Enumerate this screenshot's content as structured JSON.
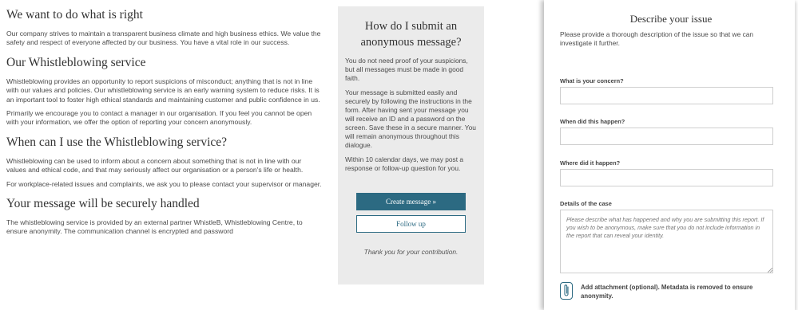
{
  "info": {
    "h1": "We want to do what is right",
    "p1": "Our company strives to maintain a transparent business climate and high business ethics. We value the safety and respect of everyone affected by our business. You have a vital role in our success.",
    "h2": "Our Whistleblowing service",
    "p2": "Whistleblowing provides an opportunity to report suspicions of misconduct; anything that is not in line with our values and policies.  Our whistleblowing service is an early warning system to reduce risks. It is an important tool to foster high ethical standards and maintaining customer and public confidence in us.",
    "p3": "Primarily we encourage you to contact a manager in our organisation. If you feel you cannot be open with your information, we offer the option of reporting your concern anonymously.",
    "h3": "When can I use the Whistleblowing service?",
    "p4": "Whistleblowing can be used to inform about a concern about something that is not in line with our values and ethical code, and that may seriously affect our organisation or a person's life or health.",
    "p5": "For workplace-related issues and complaints, we ask you to please contact your supervisor or manager.",
    "h4": "Your message will be securely handled",
    "p6": "The whistleblowing service is provided by an external partner WhistleB, Whistleblowing Centre, to ensure anonymity. The communication channel is encrypted and password"
  },
  "card": {
    "title": "How do I submit an anonymous message?",
    "p1": "You do not need proof of your suspicions, but all messages must be made in good faith.",
    "p2": "Your message is submitted easily and securely by following the instructions in the form. After having sent your message you will receive an ID and a password on the screen. Save these in a secure manner. You will remain anonymous throughout this dialogue.",
    "p3": "Within 10 calendar days, we may post a response or follow-up question for you.",
    "create_label": "Create message »",
    "follow_label": "Follow up",
    "thanks": "Thank you for your contribution."
  },
  "form": {
    "title": "Describe your issue",
    "description": "Please provide a thorough description of the issue so that we can investigate it further.",
    "concern_label": "What is your concern?",
    "concern_value": "",
    "when_label": "When did this happen?",
    "when_value": "",
    "where_label": "Where did it happen?",
    "where_value": "",
    "details_label": "Details of the case",
    "details_placeholder": "Please describe what has happened and why you are submitting this report. If you wish to be anonymous, make sure that you do not include information in the report that can reveal your identity.",
    "attachment_label": "Add attachment (optional). Metadata is removed to ensure anonymity."
  },
  "colors": {
    "accent": "#2c6a82",
    "card_bg": "#ebebeb",
    "text": "#444444"
  },
  "icons": {
    "attachment": "paperclip-icon"
  }
}
